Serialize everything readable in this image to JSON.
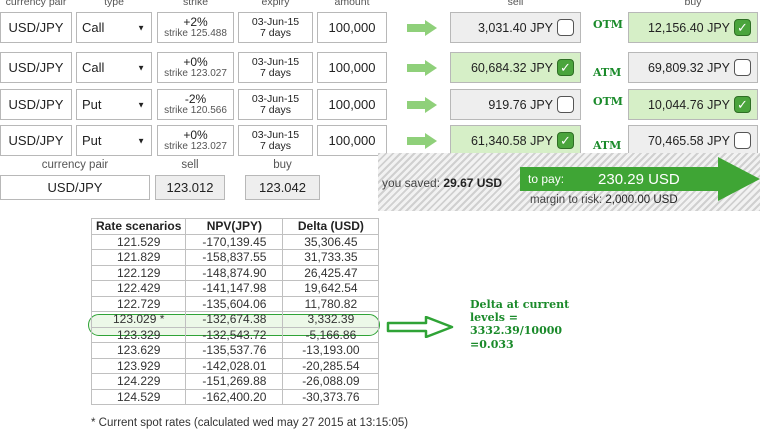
{
  "headers": {
    "currency_pair": "currency pair",
    "type": "type",
    "strike": "strike",
    "expiry": "expiry",
    "amount": "amount",
    "sell": "sell",
    "buy": "buy"
  },
  "legs": [
    {
      "pair": "USD/JPY",
      "type": "Call",
      "pct": "+2%",
      "strike": "strike 125.488",
      "date": "03-Jun-15",
      "days": "7 days",
      "amount": "100,000",
      "sell": "3,031.40 JPY",
      "sell_checked": false,
      "moneyness": "OTM",
      "buy": "12,156.40 JPY",
      "buy_checked": true
    },
    {
      "pair": "USD/JPY",
      "type": "Call",
      "pct": "+0%",
      "strike": "strike 123.027",
      "date": "03-Jun-15",
      "days": "7 days",
      "amount": "100,000",
      "sell": "60,684.32 JPY",
      "sell_checked": true,
      "moneyness": "ATM",
      "buy": "69,809.32 JPY",
      "buy_checked": false
    },
    {
      "pair": "USD/JPY",
      "type": "Put",
      "pct": "-2%",
      "strike": "strike 120.566",
      "date": "03-Jun-15",
      "days": "7 days",
      "amount": "100,000",
      "sell": "919.76 JPY",
      "sell_checked": false,
      "moneyness": "OTM",
      "buy": "10,044.76 JPY",
      "buy_checked": true
    },
    {
      "pair": "USD/JPY",
      "type": "Put",
      "pct": "+0%",
      "strike": "strike 123.027",
      "date": "03-Jun-15",
      "days": "7 days",
      "amount": "100,000",
      "sell": "61,340.58 JPY",
      "sell_checked": true,
      "moneyness": "ATM",
      "buy": "70,465.58 JPY",
      "buy_checked": false
    }
  ],
  "quote": {
    "pair_label": "currency pair",
    "sell_label": "sell",
    "buy_label": "buy",
    "pair": "USD/JPY",
    "sell": "123.012",
    "buy": "123.042"
  },
  "payment": {
    "saved_label": "you saved:",
    "saved_value": "29.67 USD",
    "pay_label": "to pay:",
    "pay_value": "230.29 USD",
    "margin_label": "margin to risk:",
    "margin_value": "2,000.00 USD"
  },
  "scenarios": {
    "headers": [
      "Rate scenarios",
      "NPV(JPY)",
      "Delta (USD)"
    ],
    "rows": [
      [
        "121.529",
        "-170,139.45",
        "35,306.45"
      ],
      [
        "121.829",
        "-158,837.55",
        "31,733.35"
      ],
      [
        "122.129",
        "-148,874.90",
        "26,425.47"
      ],
      [
        "122.429",
        "-141,147.98",
        "19,642.54"
      ],
      [
        "122.729",
        "-135,604.06",
        "11,780.82"
      ],
      [
        "123.029 *",
        "-132,674.38",
        "3,332.39"
      ],
      [
        "123.329",
        "-132,543.72",
        "-5,166.86"
      ],
      [
        "123.629",
        "-135,537.76",
        "-13,193.00"
      ],
      [
        "123.929",
        "-142,028.01",
        "-20,285.54"
      ],
      [
        "124.229",
        "-151,269.88",
        "-26,088.09"
      ],
      [
        "124.529",
        "-162,400.20",
        "-30,373.76"
      ]
    ],
    "highlight_index": 5,
    "footnote": "* Current spot rates (calculated wed may 27 2015 at 13:15:05)"
  },
  "annotation": "Delta at current\nlevels =\n3332.39/10000\n=0.033",
  "colors": {
    "accent_green": "#3fa535",
    "annotation_green": "#1a8a2a",
    "picked_bg": "#d6efc7"
  }
}
